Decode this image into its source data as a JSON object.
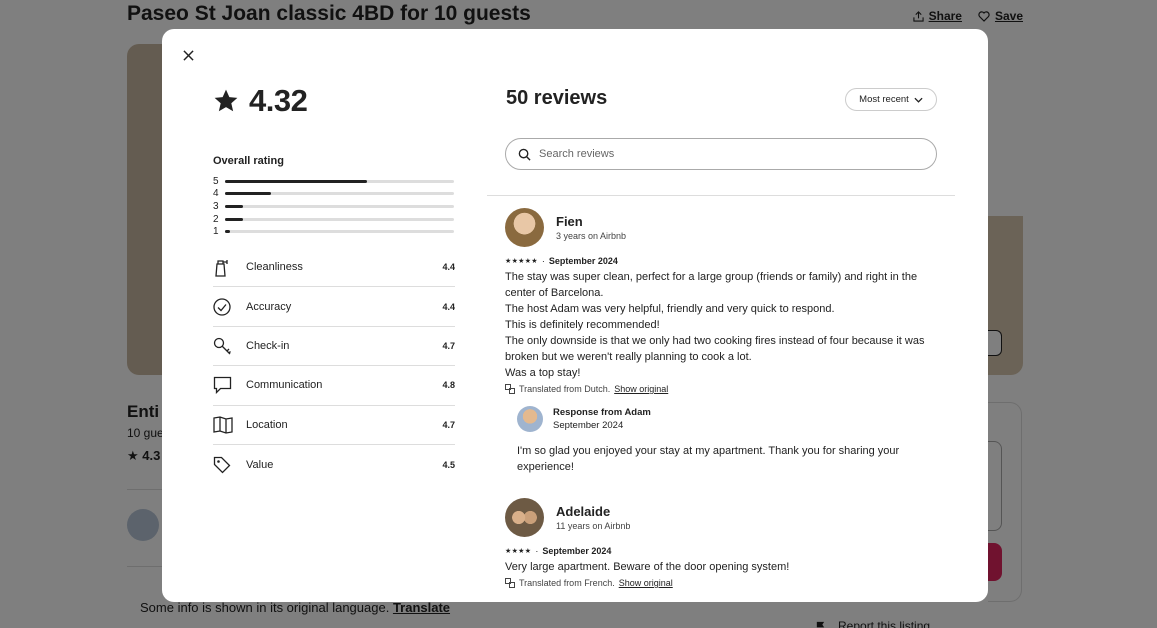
{
  "background": {
    "title": "Paseo St Joan classic 4BD for 10 guests",
    "share_label": "Share",
    "save_label": "Save",
    "entire_label": "Enti",
    "guests_label": "10 gue",
    "rating_label": "★ 4.3",
    "translate_text": "Some info is shown in its original language. ",
    "translate_link": "Translate",
    "report_label": "Report this listing"
  },
  "modal": {
    "overall_score": "4.32",
    "overall_label": "Overall rating",
    "distribution": [
      {
        "stars": "5",
        "fraction": 0.62
      },
      {
        "stars": "4",
        "fraction": 0.2
      },
      {
        "stars": "3",
        "fraction": 0.08
      },
      {
        "stars": "2",
        "fraction": 0.08
      },
      {
        "stars": "1",
        "fraction": 0.02
      }
    ],
    "categories": [
      {
        "label": "Cleanliness",
        "value": "4.4",
        "icon": "spray-bottle-icon"
      },
      {
        "label": "Accuracy",
        "value": "4.4",
        "icon": "check-circle-icon"
      },
      {
        "label": "Check-in",
        "value": "4.7",
        "icon": "key-icon"
      },
      {
        "label": "Communication",
        "value": "4.8",
        "icon": "chat-bubble-icon"
      },
      {
        "label": "Location",
        "value": "4.7",
        "icon": "map-icon"
      },
      {
        "label": "Value",
        "value": "4.5",
        "icon": "tag-icon"
      }
    ],
    "reviews_count": "50 reviews",
    "sort_label": "Most recent",
    "search_placeholder": "Search reviews",
    "reviews": [
      {
        "name": "Fien",
        "tenure": "3 years on Airbnb",
        "stars": "★★★★★",
        "date": "September 2024",
        "text": "The stay was super clean, perfect for a large group (friends or family) and right in the center of Barcelona.\nThe host Adam was very helpful, friendly and very quick to respond.\nThis is definitely recommended!\nThe only downside is that we only had two cooking fires instead of four because it was broken but we weren't really planning to cook a lot.\nWas a top stay!",
        "translated": "Translated from Dutch.",
        "show_original": "Show original",
        "response": {
          "title": "Response from Adam",
          "date": "September 2024",
          "text": "I'm so glad you enjoyed your stay at my apartment. Thank you for sharing your experience!"
        }
      },
      {
        "name": "Adelaide",
        "tenure": "11 years on Airbnb",
        "stars": "★★★★",
        "date": "September 2024",
        "text": "Very large apartment. Beware of the door opening system!",
        "translated": "Translated from French.",
        "show_original": "Show original"
      }
    ]
  }
}
